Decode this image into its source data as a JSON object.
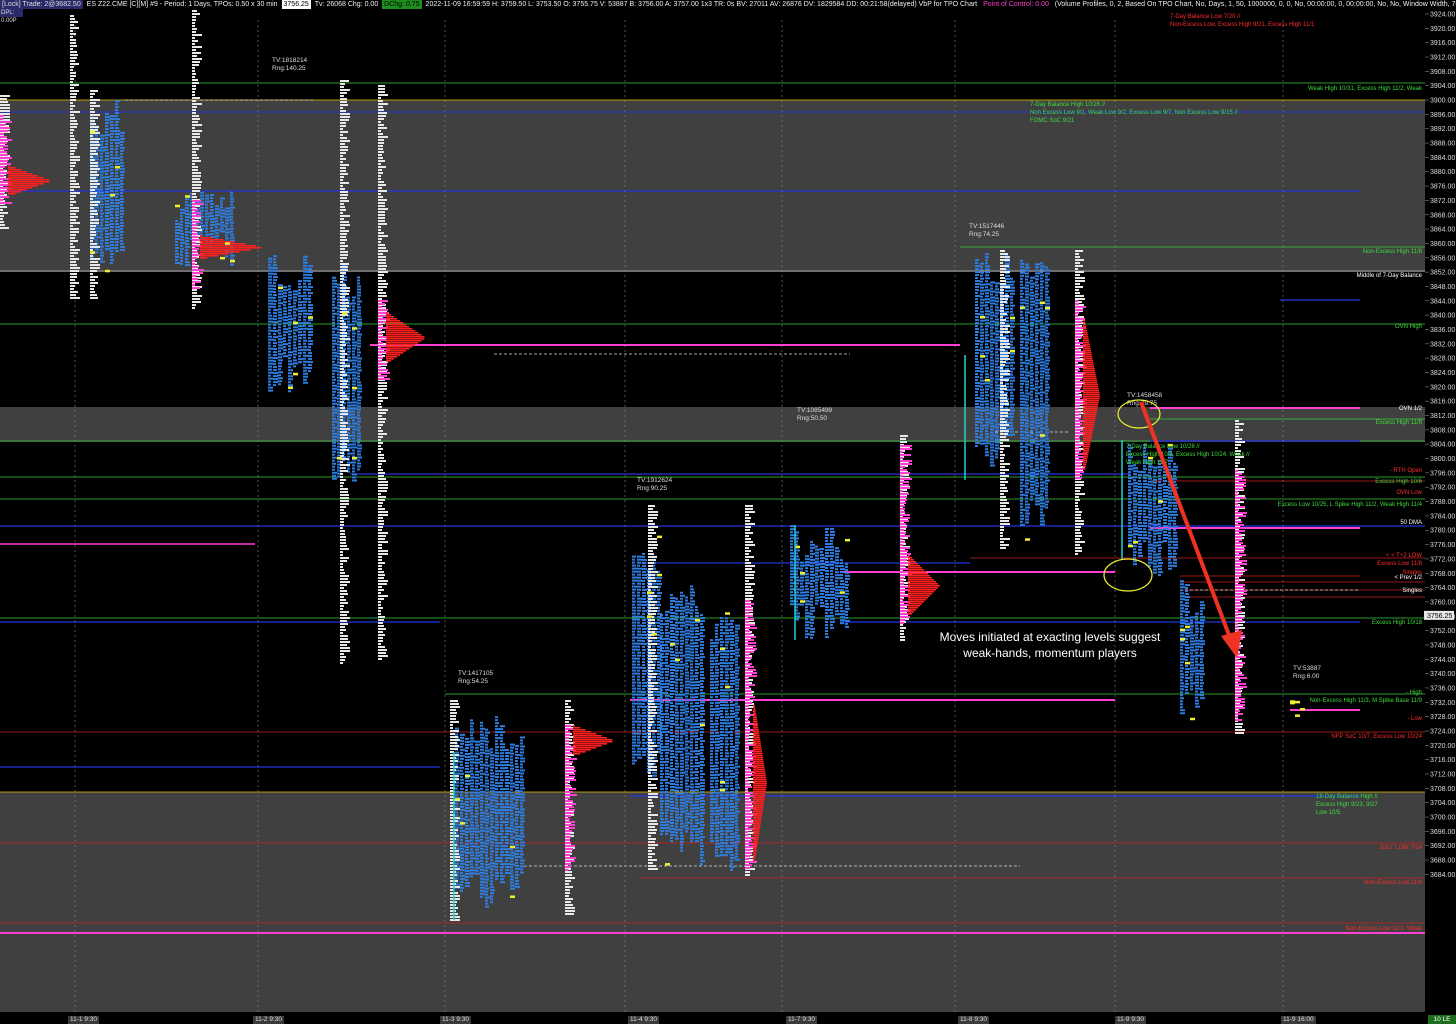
{
  "topbar": {
    "lock_label": "[Lock] Trade: 2@3682.50",
    "symbol_info": "ES Z22.CME [C][M]  #9 - Period: 1 Days, TPOs: 0.50 x 30 min",
    "last_price": "3756.25",
    "tv_info": "Tv: 26068  Chg: 0.00",
    "day_change": "DChg: 0.75",
    "bar_info": "2022-11-09 16:59:59 H: 3759.50 L: 3753.50 O: 3755.75 V: 53887 B: 3756.00 A: 3757.00 1x3 TR: 0s BV: 27011 AV: 26876 DV: 1829584 DD: 00:21:58(delayed) VbP for TPO Chart",
    "poc_text": "Point of Control: 0.00",
    "study_text": "(Volume Profiles, 0, 2, Based On TPO Chart, No, Days, 1, 50, 1000000, 0, 0, No, 00:00:00, 0, 00:00:00, No, No, Window Width, 70, No"
  },
  "dpl_label": "DPL: 0.00P",
  "price_axis": {
    "labels": [
      "3924.00",
      "3920.00",
      "3916.00",
      "3912.00",
      "3908.00",
      "3904.00",
      "3900.00",
      "3896.00",
      "3892.00",
      "3888.00",
      "3884.00",
      "3880.00",
      "3876.00",
      "3872.00",
      "3868.00",
      "3864.00",
      "3860.00",
      "3856.00",
      "3852.00",
      "3848.00",
      "3844.00",
      "3840.00",
      "3836.00",
      "3832.00",
      "3828.00",
      "3824.00",
      "3820.00",
      "3816.00",
      "3812.00",
      "3808.00",
      "3804.00",
      "3800.00",
      "3796.00",
      "3792.00",
      "3788.00",
      "3784.00",
      "3780.00",
      "3776.00",
      "3772.00",
      "3768.00",
      "3764.00",
      "3760.00",
      "3756.00",
      "3752.00",
      "3748.00",
      "3744.00",
      "3740.00",
      "3736.00",
      "3732.00",
      "3728.00",
      "3724.00",
      "3720.00",
      "3716.00",
      "3712.00",
      "3708.00",
      "3704.00",
      "3700.00",
      "3696.00",
      "3692.00",
      "3688.00",
      "3684.00"
    ],
    "current_price": "3756.25"
  },
  "time_axis": [
    "11-1  9:30",
    "11-2  9:30",
    "11-3  9:30",
    "11-4  9:30",
    "11-7  9:30",
    "11-8  9:30",
    "11-9  9:30",
    "11-9  16:00"
  ],
  "corner_label": "10 LE",
  "session_stats": [
    {
      "tv": "TV:1818214",
      "rng": "Rng:140.25"
    },
    {
      "tv": "TV:1417105",
      "rng": "Rng:54.25"
    },
    {
      "tv": "TV:1912624",
      "rng": "Rng:90.25"
    },
    {
      "tv": "TV:1085499",
      "rng": "Rng:50.50"
    },
    {
      "tv": "TV:1517446",
      "rng": "Rng:74.25"
    },
    {
      "tv": "TV:1458458",
      "rng": "Rng:79.75"
    },
    {
      "tv": "TV:53887",
      "rng": "Rng:6.00"
    }
  ],
  "level_labels": [
    {
      "text": "7-Day Balance Low 7/20 //",
      "color": "#ff2a2a"
    },
    {
      "text": "Non-Excess Low, Excess High 9/21, Excess High 11/1",
      "color": "#ff2a2a"
    },
    {
      "text": "Weak High 10/31, Excess High 11/2, Weak",
      "color": "#3ddc3d"
    },
    {
      "text": "7-Day Balance High 10/26 //",
      "color": "#3ddc3d"
    },
    {
      "text": "Non Excess Low 9/1, Weak Low 9/2, Excess Low 9/7, Non Excess Low 9/15 //",
      "color": "#3ddc3d"
    },
    {
      "text": "FOMC SoC 9/21",
      "color": "#3ddc3d"
    },
    {
      "text": "Non-Excess High 11/8",
      "color": "#3ddc3d"
    },
    {
      "text": "Middle of 7-Day Balance",
      "color": "#ffffff"
    },
    {
      "text": "OVN High",
      "color": "#3ddc3d"
    },
    {
      "text": "OVN 1/2",
      "color": "#ffffff"
    },
    {
      "text": "Excess High 11/9",
      "color": "#3ddc3d"
    },
    {
      "text": "7-Day Balance Low 10/28 //",
      "color": "#3ddc3d"
    },
    {
      "text": "Excess High 10/5, Excess High 10/24, Weak //",
      "color": "#3ddc3d"
    },
    {
      "text": "Weak High 11/7",
      "color": "#3ddc3d"
    },
    {
      "text": "- RTH Open",
      "color": "#ff2a2a"
    },
    {
      "text": "Excess High 10/6",
      "color": "#3ddc3d"
    },
    {
      "text": "OVN Low",
      "color": "#ff2a2a"
    },
    {
      "text": "Excess Low 10/25, L Spike High 11/2, Weak High 11/4",
      "color": "#3ddc3d"
    },
    {
      "text": "50 DMA",
      "color": "#ffffff"
    },
    {
      "text": "< < T+2 LOW",
      "color": "#ff2a2a"
    },
    {
      "text": "Excess Low 11/8",
      "color": "#ff2a2a"
    },
    {
      "text": "Singles",
      "color": "#ff2a2a"
    },
    {
      "text": "< Prev 1/2",
      "color": "#ffffff"
    },
    {
      "text": "Singles",
      "color": "#ffffff"
    },
    {
      "text": "Excess High 10/18",
      "color": "#3ddc3d"
    },
    {
      "text": "- High",
      "color": "#3ddc3d"
    },
    {
      "text": "Non-Excess High 11/3, M Spike Base 11/9",
      "color": "#3ddc3d"
    },
    {
      "text": "- Low",
      "color": "#ff2a2a"
    },
    {
      "text": "NFP SoC 10/7, Excess Low 10/24",
      "color": "#ff2a2a"
    },
    {
      "text": "18-Day Balance High //",
      "color": "#3ddc3d"
    },
    {
      "text": "Excess High 9/23, 9/27",
      "color": "#3ddc3d"
    },
    {
      "text": "Low 10/5",
      "color": "#3ddc3d"
    },
    {
      "text": "JULY LOW 7/14",
      "color": "#ff2a2a"
    },
    {
      "text": "Non-Excess Low 11/4",
      "color": "#ff2a2a"
    },
    {
      "text": "Non-Excess Low 11/3, Weak",
      "color": "#ff2a2a"
    }
  ],
  "annotation": {
    "line1": "Moves initiated at exacting levels suggest",
    "line2": "weak-hands, momentum players"
  },
  "colors": {
    "blue_tpo": "#2e7de0",
    "white_tpo": "#e8e8e8",
    "magenta": "#ff3fd0",
    "red_profile": "#ff2020",
    "green_level": "#39d039",
    "red_level": "#cc2020",
    "blue_level": "#2233dd",
    "yellow_poc": "#f0f030",
    "arrow": "#ee3322"
  }
}
